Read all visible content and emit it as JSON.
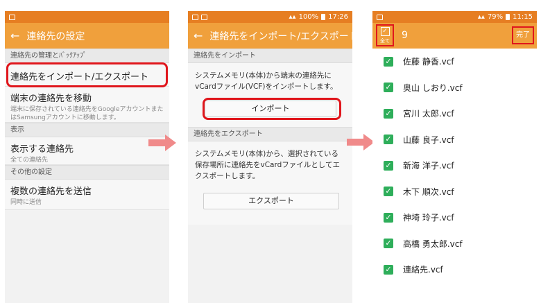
{
  "screen1": {
    "title": "連絡先の設定",
    "sections": [
      {
        "header": "連絡先の管理とﾊﾞｯｸｱｯﾌﾟ"
      },
      {
        "header": "表示"
      },
      {
        "header": "その他の設定"
      }
    ],
    "items": [
      {
        "title": "連絡先をインポート/エクスポート",
        "sub": ""
      },
      {
        "title": "端末の連絡先を移動",
        "sub": "端末に保存されている連絡先をGoogleアカウントまたはSamsungアカウントに移動します。"
      },
      {
        "title": "表示する連絡先",
        "sub": "全ての連絡先"
      },
      {
        "title": "複数の連絡先を送信",
        "sub": "同時に送信"
      }
    ]
  },
  "screen2": {
    "status": {
      "battery": "100%",
      "time": "17:26"
    },
    "title": "連絡先をインポート/エクスポート",
    "import_header": "連絡先をインポート",
    "import_text": "システムメモリ(本体)から端末の連絡先にvCardファイル(VCF)をインポートします。",
    "import_button": "インポート",
    "export_header": "連絡先をエクスポート",
    "export_text": "システムメモリ(本体)から、選択されている保存場所に連絡先をvCardファイルとしてエクスポートします。",
    "export_button": "エクスポート"
  },
  "screen3": {
    "status": {
      "battery": "79%",
      "time": "11:15"
    },
    "all_label": "全て",
    "count": "9",
    "done": "完了",
    "files": [
      "佐藤 静香.vcf",
      "奥山 しおり.vcf",
      "宮川 太郎.vcf",
      "山藤 良子.vcf",
      "新海 洋子.vcf",
      "木下 順次.vcf",
      "神埼 玲子.vcf",
      "高橋 勇太郎.vcf",
      "連絡先.vcf"
    ]
  },
  "colors": {
    "appbar": "#f0a03c",
    "statusbar": "#e67e22",
    "highlight": "#e0161c",
    "checkbox": "#2eae5a",
    "arrow": "#f08a8a"
  }
}
